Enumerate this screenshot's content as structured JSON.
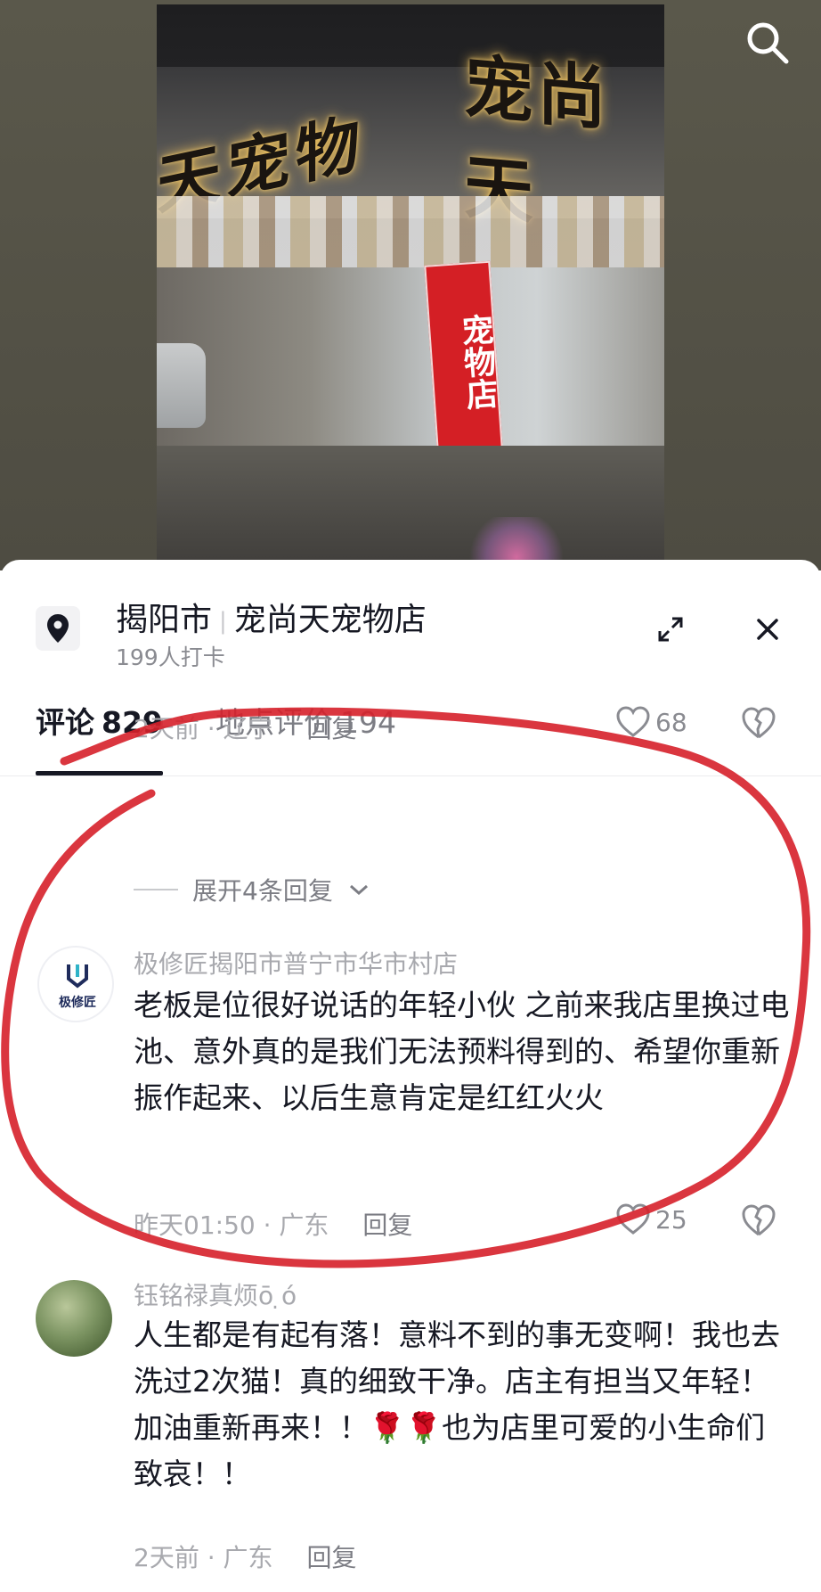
{
  "icons": {
    "search": "search-icon",
    "location": "location-pin-icon",
    "expand": "expand-icon",
    "close": "close-icon",
    "like": "heart-icon",
    "dislike": "broken-heart-icon",
    "chevron": "chevron-down-icon"
  },
  "colors": {
    "text_primary": "#161823",
    "text_secondary": "#a8a9ae",
    "annotation_red": "#d6202a",
    "store_board": "#d41f25"
  },
  "photo": {
    "sign_left": "天宠物",
    "sign_right": "宠尚天",
    "board_text": "宠物店"
  },
  "location": {
    "city": "揭阳市",
    "shop": "宠尚天宠物店",
    "checkins": "199人打卡"
  },
  "tabs": [
    {
      "label": "评论",
      "count": "829",
      "active": true
    },
    {
      "label": "地点评价",
      "count": "194",
      "active": false
    }
  ],
  "comments": [
    {
      "time": "2天前 · 辽宁",
      "reply": "回复",
      "likes": "68"
    },
    {
      "username": "极修匠揭阳市普宁市华市村店",
      "avatar_text": "极修匠",
      "text": "老板是位很好说话的年轻小伙 之前来我店里换过电池、意外真的是我们无法预料得到的、希望你重新振作起来、以后生意肯定是红红火火",
      "time": "昨天01:50 · 广东",
      "reply": "回复",
      "likes": "25"
    },
    {
      "username": "钰铭禄真烦ō ̣ó",
      "text": "人生都是有起有落！意料不到的事无变啊！我也去洗过2次猫！真的细致干净。店主有担当又年轻！加油重新再来！！🌹🌹也为店里可爱的小生命们致哀！！",
      "time": "2天前 · 广东",
      "reply": "回复"
    }
  ],
  "expand_replies": "展开4条回复"
}
